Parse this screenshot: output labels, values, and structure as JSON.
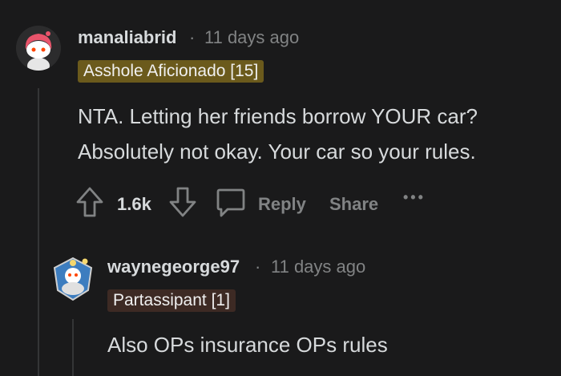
{
  "comment": {
    "username": "manaliabrid",
    "separator": "·",
    "time": "11 days ago",
    "flair": "Asshole Aficionado [15]",
    "flair_color": "#6b5a1c",
    "body_line1": "NTA. Letting her friends borrow YOUR car?",
    "body_line2": "Absolutely not okay. Your car so your rules.",
    "votes": "1.6k",
    "reply_label": "Reply",
    "share_label": "Share",
    "more_label": "•••"
  },
  "reply": {
    "username": "waynegeorge97",
    "separator": "·",
    "time": "11 days ago",
    "flair": "Partassipant [1]",
    "flair_color": "#3d2a24",
    "body": "Also OPs insurance OPs rules"
  },
  "icons": {
    "upvote": "arrow-up-icon",
    "downvote": "arrow-down-icon",
    "reply": "speech-bubble-icon",
    "more": "ellipsis-icon"
  }
}
